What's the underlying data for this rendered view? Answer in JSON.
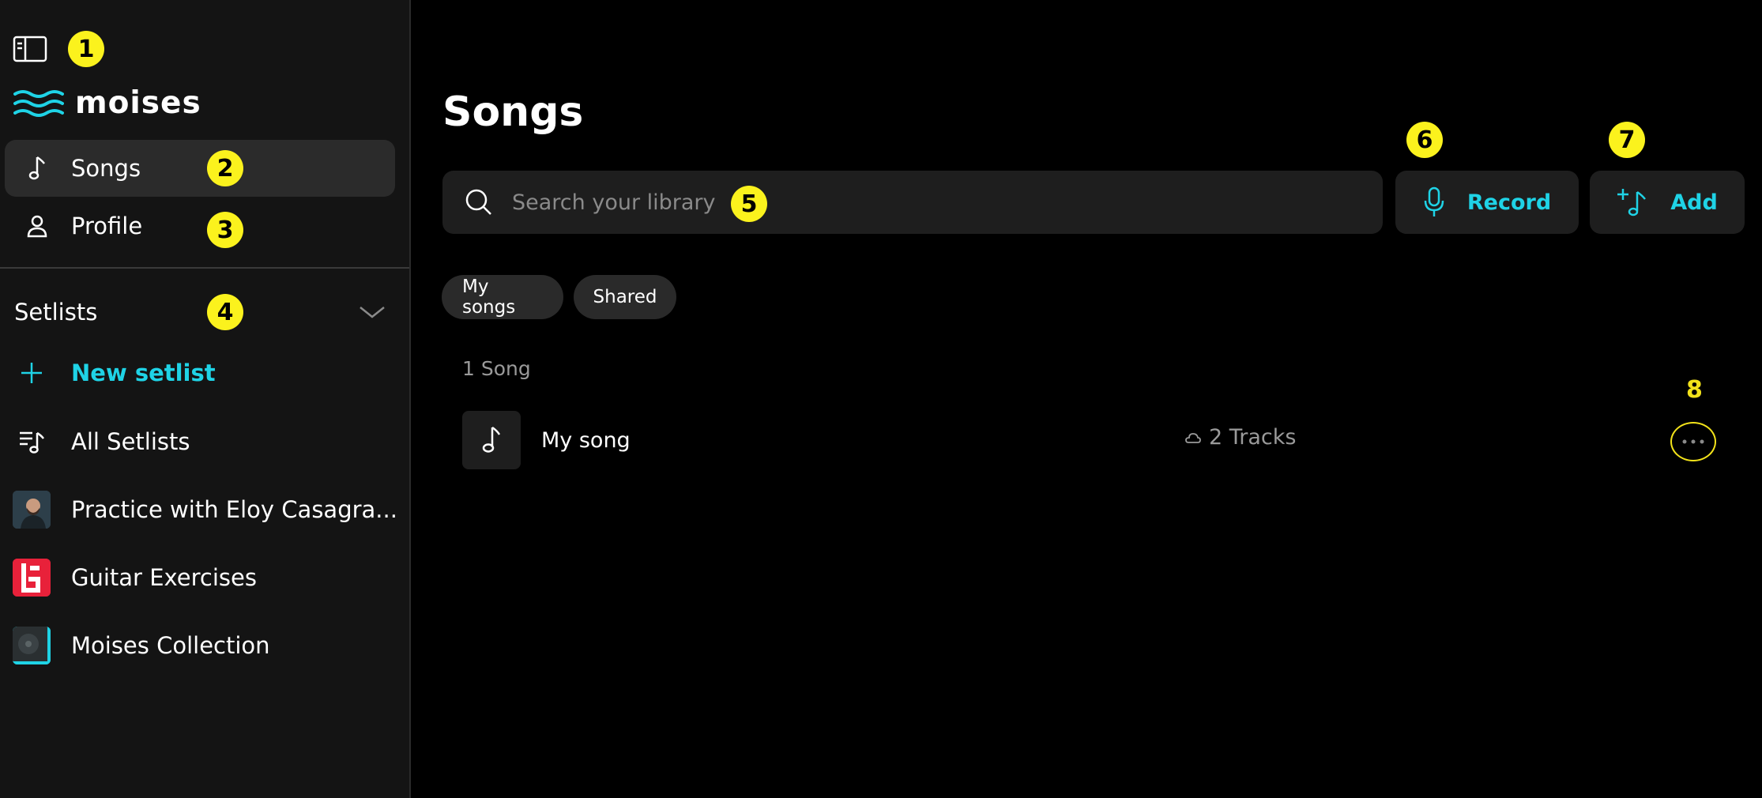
{
  "app": {
    "logo_text": "moises",
    "accent": "#1fd3e6",
    "marker_color": "#fbf21d"
  },
  "sidebar": {
    "nav": [
      {
        "label": "Songs",
        "icon": "music-note-icon",
        "active": true
      },
      {
        "label": "Profile",
        "icon": "person-icon",
        "active": false
      }
    ],
    "setlists": {
      "title": "Setlists",
      "new_label": "New setlist",
      "all_label": "All Setlists",
      "items": [
        {
          "label": "Practice with Eloy Casagra..."
        },
        {
          "label": "Guitar Exercises"
        },
        {
          "label": "Moises Collection"
        }
      ]
    }
  },
  "main": {
    "title": "Songs",
    "search": {
      "placeholder": "Search your library"
    },
    "record_label": "Record",
    "add_label": "Add",
    "tabs": [
      {
        "label": "My songs"
      },
      {
        "label": "Shared"
      }
    ],
    "song_count": "1 Song",
    "songs": [
      {
        "title": "My song",
        "tracks": "2 Tracks"
      }
    ]
  },
  "markers": [
    "1",
    "2",
    "3",
    "4",
    "5",
    "6",
    "7",
    "8"
  ]
}
